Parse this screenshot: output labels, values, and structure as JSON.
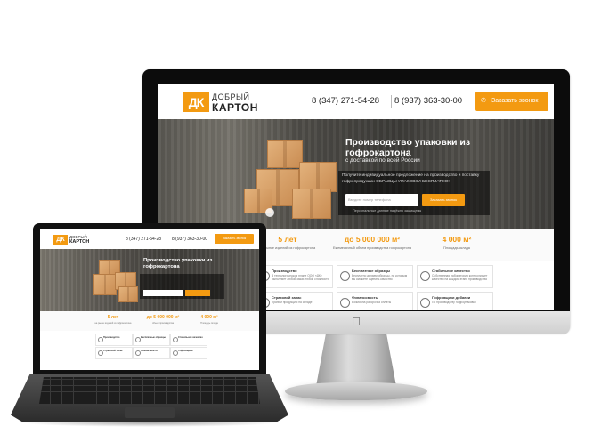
{
  "colors": {
    "accent": "#f39a11",
    "dark": "#0c0c0c"
  },
  "monitor": {
    "logo": {
      "mark": "ДК",
      "line1": "ДОБРЫЙ",
      "line2": "КАРТОН"
    },
    "phone1": "8 (347) 271-54-28",
    "phone2": "8 (937) 363-30-00",
    "call_button": "Заказать звонок",
    "call_icon": "phone-icon",
    "hero_title": "Производство упаковки из гофрокартона",
    "hero_subtitle": "с доставкой по всей России",
    "offer": "Получите индивидуальное предложение на производство и поставку гофропродукции ОБРАЗЦЫ УПАКОВКИ БЕСПЛАТНО!",
    "input_placeholder": "Введите номер телефона",
    "send_button": "Заказать звонок",
    "privacy": "Персональные данные надёжно защищены",
    "stats": [
      {
        "value": "5 лет",
        "label": "на рынке изделий из гофрокартона"
      },
      {
        "value": "до 5 000 000 м²",
        "label": "Ежемесячный объем производства гофрокартона"
      },
      {
        "value": "4 000 м²",
        "label": "Площадь склада"
      }
    ],
    "features": [
      {
        "title": "Производство",
        "desc": "В технологическом плане ООО «ДК» выполняет любой заказ любой сложности",
        "icon": "factory-icon"
      },
      {
        "title": "Бесплатные образцы",
        "desc": "Бесплатно делаем образцы, по которым вы сможете оценить качество",
        "icon": "sample-icon"
      },
      {
        "title": "Стабильное качество",
        "desc": "Собственная лаборатория контролирует качество на каждом этапе производства",
        "icon": "quality-icon"
      },
      {
        "title": "Страховой запас",
        "desc": "Храним продукцию на складе",
        "icon": "stock-icon"
      },
      {
        "title": "Финансовость",
        "desc": "Возможна рассрочка оплаты",
        "icon": "finance-icon"
      },
      {
        "title": "Гофроящики добавки",
        "desc": "По производству гофроупаковки",
        "icon": "box-icon"
      }
    ]
  },
  "laptop": {
    "logo": {
      "mark": "ДК",
      "line1": "ДОБРЫЙ",
      "line2": "КАРТОН"
    },
    "phone1": "8 (347) 271-54-28",
    "phone2": "8 (937) 363-30-00",
    "call_button": "Заказать звонок",
    "hero_title": "Производство упаковки из гофрокартона",
    "stats": [
      {
        "value": "5 лет",
        "label": "на рынке изделий из гофрокартона"
      },
      {
        "value": "до 5 000 000 м²",
        "label": "объем производства"
      },
      {
        "value": "4 000 м²",
        "label": "Площадь склада"
      }
    ],
    "features": [
      "Производство",
      "Бесплатные образцы",
      "Стабильное качество",
      "Страховой запас",
      "Финансовость",
      "Гофроящики"
    ]
  }
}
